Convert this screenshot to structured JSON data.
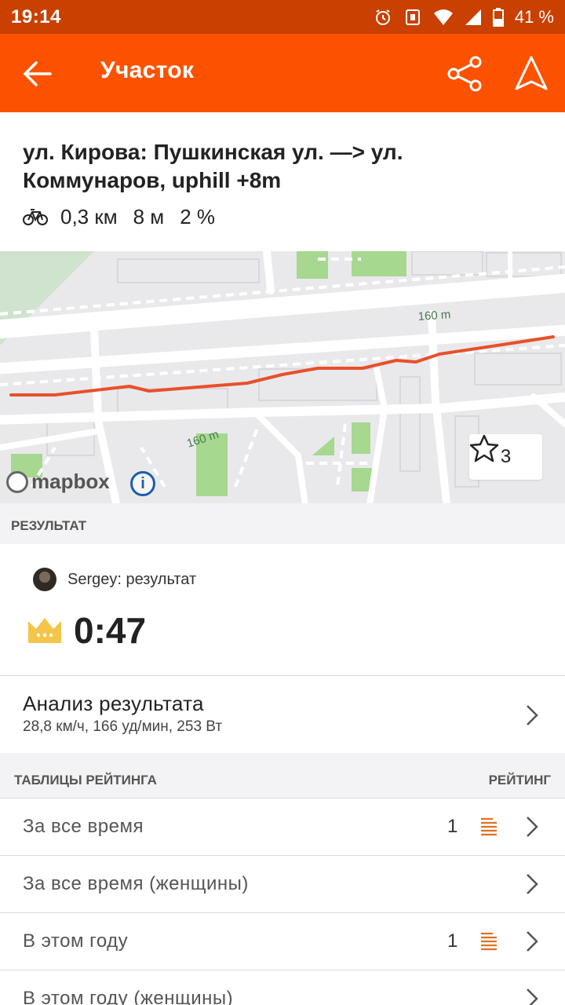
{
  "status_bar": {
    "time": "19:14",
    "battery": "41 %"
  },
  "app_bar": {
    "title": "Участок"
  },
  "segment": {
    "name": "ул. Кирова: Пушкинская ул. —> ул. Коммунаров, uphill +8m",
    "distance": "0,3 км",
    "elevation": "8 м",
    "grade": "2 %"
  },
  "map": {
    "label_1": "160 m",
    "label_2": "160 m",
    "attribution": "mapbox",
    "star_count": "3",
    "route_color": "#e8502a"
  },
  "result_section": {
    "header": "РЕЗУЛЬТАТ"
  },
  "result": {
    "athlete_label": "Sergey: результат",
    "time": "0:47"
  },
  "analysis": {
    "title": "Анализ результата",
    "subtitle": "28,8 км/ч, 166 уд/мин, 253 Вт"
  },
  "leaderboards": {
    "header_left": "ТАБЛИЦЫ РЕЙТИНГА",
    "header_right": "РЕЙТИНГ",
    "rows": [
      {
        "label": "За все время",
        "rank": "1"
      },
      {
        "label": "За все время (женщины)",
        "rank": ""
      },
      {
        "label": "В этом году",
        "rank": "1"
      },
      {
        "label": "В этом году (женщины)",
        "rank": ""
      }
    ]
  },
  "colors": {
    "brand": "#fc5200",
    "status_bar": "#c94000",
    "crown": "#f4c54a"
  }
}
